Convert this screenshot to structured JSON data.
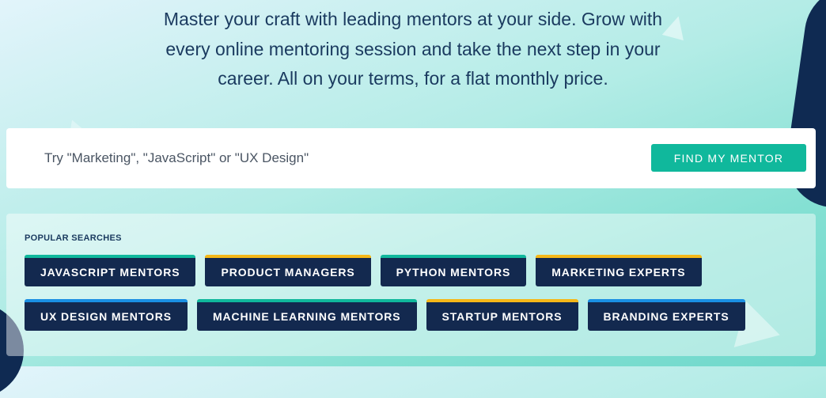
{
  "hero": {
    "line1": "Master your craft with leading mentors at your side. Grow with",
    "line2": "every online mentoring session and take the next step in your",
    "line3": "career. All on your terms, for a flat monthly price."
  },
  "search": {
    "placeholder": "Try \"Marketing\", \"JavaScript\" or \"UX Design\"",
    "button_label": "FIND MY MENTOR"
  },
  "popular": {
    "title": "POPULAR SEARCHES",
    "row1": [
      {
        "label": "JAVASCRIPT MENTORS",
        "accent": "#10b89c"
      },
      {
        "label": "PRODUCT MANAGERS",
        "accent": "#f5b819"
      },
      {
        "label": "PYTHON MENTORS",
        "accent": "#10b89c"
      },
      {
        "label": "MARKETING EXPERTS",
        "accent": "#f5b819"
      }
    ],
    "row2": [
      {
        "label": "UX DESIGN MENTORS",
        "accent": "#1a8fe3"
      },
      {
        "label": "MACHINE LEARNING MENTORS",
        "accent": "#10b89c"
      },
      {
        "label": "STARTUP MENTORS",
        "accent": "#f5b819"
      },
      {
        "label": "BRANDING EXPERTS",
        "accent": "#1a8fe3"
      }
    ]
  },
  "colors": {
    "chip_bg": "#13294f",
    "cta": "#10b89c",
    "text_dark": "#1a3a5f"
  }
}
